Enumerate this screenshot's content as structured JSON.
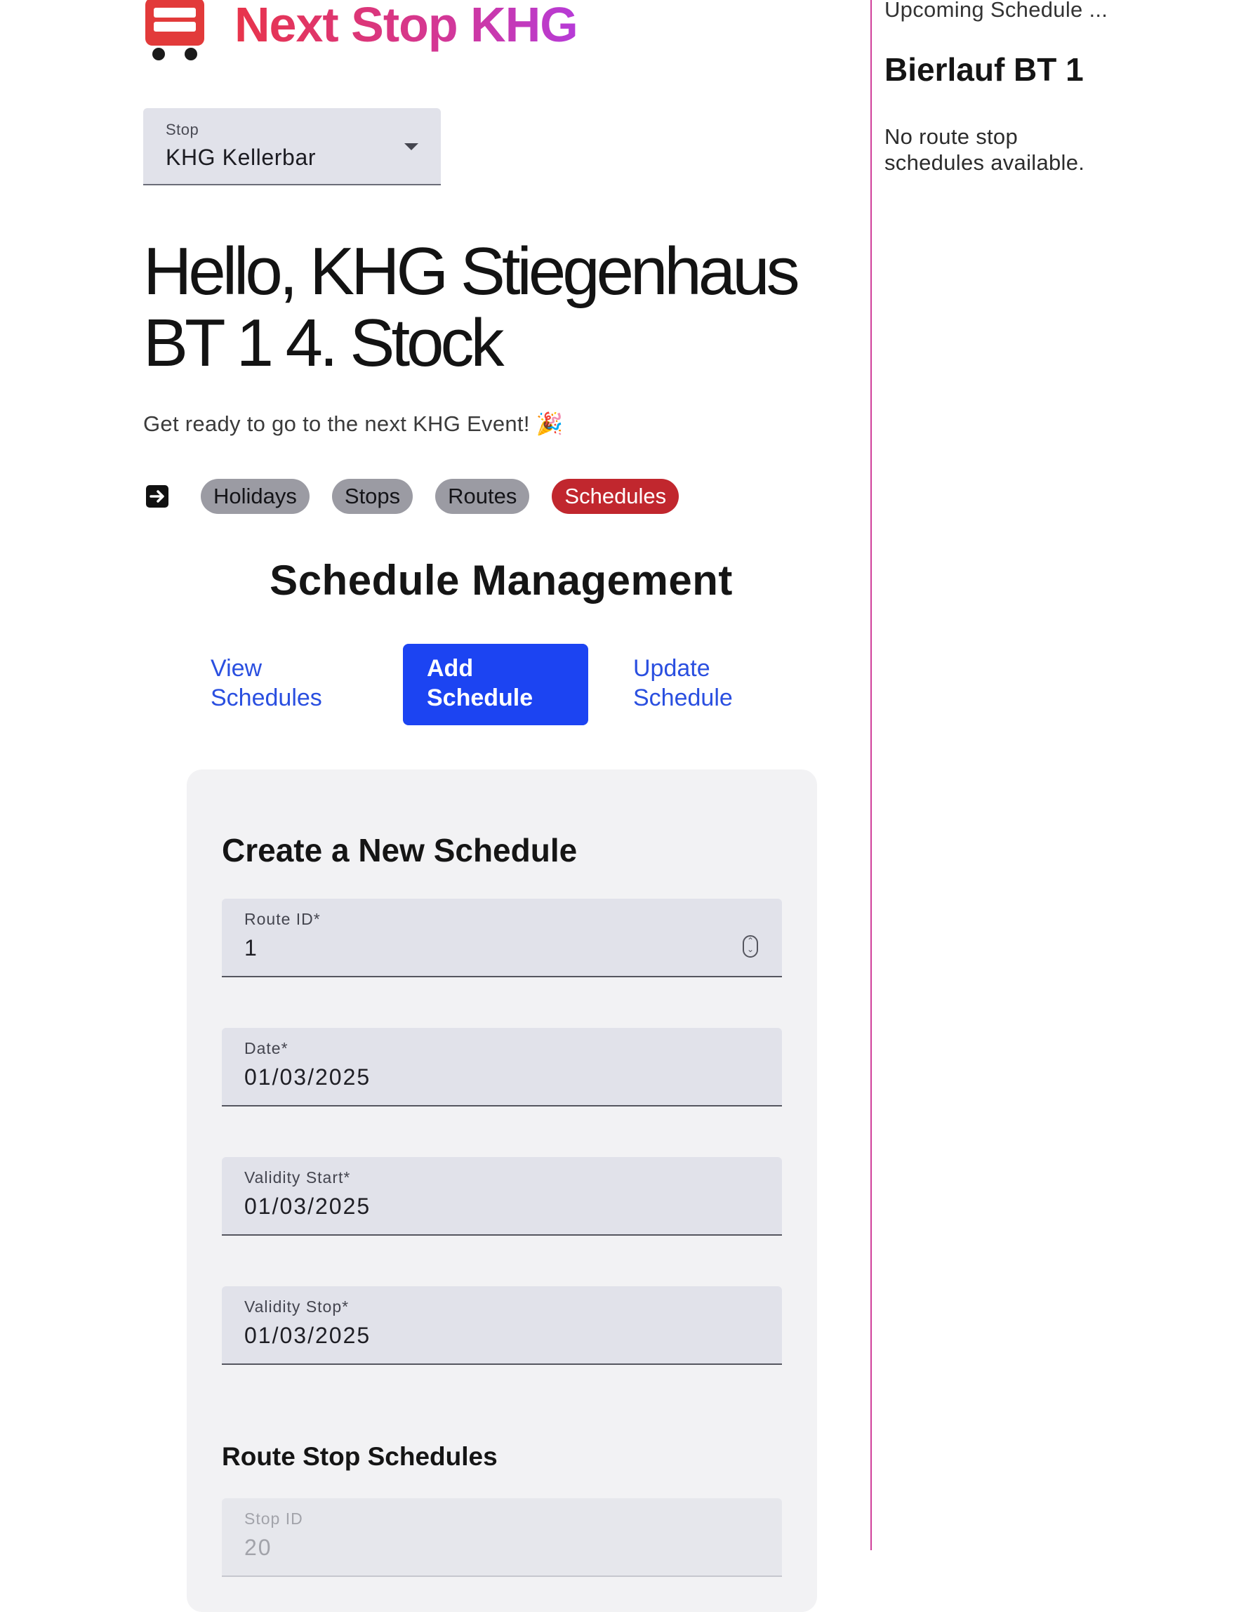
{
  "brand": {
    "title": "Next Stop KHG",
    "icon": "bus-icon"
  },
  "stop_select": {
    "label": "Stop",
    "value": "KHG Kellerbar"
  },
  "greeting": "Hello, KHG Stiegenhaus BT 1 4. Stock",
  "tagline": "Get ready to go to the next KHG Event! 🎉",
  "nav": {
    "logout_icon": "logout-icon",
    "items": [
      {
        "label": "Holidays",
        "active": false
      },
      {
        "label": "Stops",
        "active": false
      },
      {
        "label": "Routes",
        "active": false
      },
      {
        "label": "Schedules",
        "active": true
      }
    ]
  },
  "schedule_management": {
    "title": "Schedule Management",
    "tabs": [
      "View Schedules",
      "Add Schedule",
      "Update Schedule"
    ],
    "active_tab": "Add Schedule"
  },
  "form": {
    "title": "Create a New Schedule",
    "fields": [
      {
        "label": "Route ID*",
        "value": "1"
      },
      {
        "label": "Date*",
        "value": "01/03/2025"
      },
      {
        "label": "Validity Start*",
        "value": "01/03/2025"
      },
      {
        "label": "Validity Stop*",
        "value": "01/03/2025"
      }
    ],
    "route_stop_schedules": {
      "title": "Route Stop Schedules",
      "stop_id_label": "Stop ID",
      "stop_id_value": "20"
    }
  },
  "sidebar": {
    "heading": "Upcoming Schedule ...",
    "route_name": "Bierlauf BT 1",
    "empty_message": "No route stop schedules available."
  },
  "colors": {
    "accent_red": "#c1272e",
    "primary_blue": "#1c44f2",
    "link_blue": "#2a4fe0",
    "sidebar_border": "#d0409a"
  }
}
